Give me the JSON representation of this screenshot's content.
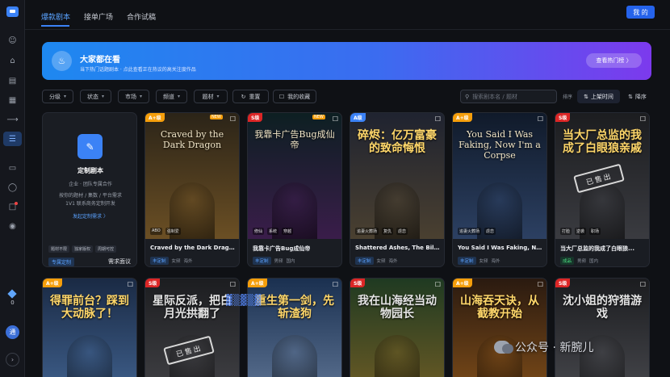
{
  "header": {
    "tabs": [
      {
        "label": "爆款剧本",
        "active": true
      },
      {
        "label": "接单广场",
        "active": false
      },
      {
        "label": "合作试稿",
        "active": false
      }
    ],
    "my_button": "我 的"
  },
  "sidebar": {
    "credits": "0",
    "avatar_letter": "通"
  },
  "banner": {
    "title": "大家都在看",
    "subtitle": "当下热门话题剧本 · 点此查看正在热议的高关注度作品",
    "button": "查看热门榜 〉"
  },
  "filters": [
    {
      "label": "分级"
    },
    {
      "label": "状态"
    },
    {
      "label": "市场"
    },
    {
      "label": "频道"
    },
    {
      "label": "题材"
    }
  ],
  "actions": {
    "reset": "重置",
    "favorites": "我的收藏"
  },
  "search": {
    "placeholder": "搜索剧本名 / 题材"
  },
  "sort": {
    "label": "排序",
    "option_a": "上架时间",
    "option_b": "降序"
  },
  "custom_card": {
    "title": "定制剧本",
    "line1": "企业 · 团队专属合作",
    "line2": "按你的题材 / 集数 / 平台需求",
    "line3": "1V1 联系商务定制开发",
    "link": "发起定制需求 〉",
    "tags": [
      "题材不限",
      "独家版权",
      "周期可控"
    ],
    "footer_tag": "专属定制",
    "footer_right": "需求面议"
  },
  "cards_row1": [
    {
      "grade": "A+级",
      "new": "NEW",
      "cover_title": "Craved by the Dark Dragon",
      "cover_tags": [
        "ABO",
        "强制爱"
      ],
      "name": "Craved by the Dark Drago...",
      "status": "丰定制",
      "meta1": "女频",
      "meta2": "海外",
      "colors": [
        "#2b2418",
        "#6b4f24"
      ]
    },
    {
      "grade": "S级",
      "new": "NEW",
      "cover_title": "我靠卡广告Bug成仙帝",
      "cover_tags": [
        "修仙",
        "系统",
        "穿越"
      ],
      "name": "我靠卡广告Bug成仙帝",
      "status": "丰定制",
      "meta1": "男频",
      "meta2": "国内",
      "colors": [
        "#0d1f22",
        "#3a1d4a"
      ]
    },
    {
      "grade": "A级",
      "new": "",
      "cover_title": "碎烬：亿万富豪的致命悔恨",
      "cover_tags": [
        "追妻火葬场",
        "复仇",
        "虐恋"
      ],
      "name": "Shattered Ashes, The Billi...",
      "status": "丰定制",
      "meta1": "女频",
      "meta2": "海外",
      "colors": [
        "#1f2330",
        "#4a4030"
      ]
    },
    {
      "grade": "A+级",
      "new": "",
      "cover_title": "You Said I Was Faking, Now I'm a Corpse",
      "cover_tags": [
        "追妻火葬场",
        "虐恋"
      ],
      "name": "You Said I Was Faking, No...",
      "status": "丰定制",
      "meta1": "女频",
      "meta2": "海外",
      "colors": [
        "#101a2a",
        "#2c4062"
      ]
    },
    {
      "grade": "S级",
      "new": "",
      "cover_title": "当大厂总监的我成了白眼狼亲戚",
      "cover_tags": [
        "打脸",
        "逆袭",
        "职场"
      ],
      "name": "当大厂总监的我成了白眼狼...",
      "status": "成品",
      "meta1": "男频",
      "meta2": "国内",
      "soldout": "已售出",
      "colors": [
        "#1c1d20",
        "#3a3b40"
      ]
    }
  ],
  "cards_row2": [
    {
      "grade": "A+级",
      "cover_title": "得罪前台？踩到大动脉了！",
      "colors": [
        "#1a2a44",
        "#3e5e8a"
      ]
    },
    {
      "grade": "S级",
      "cover_title": "星际反派，把白月光拱翻了",
      "soldout": "已售出",
      "colors": [
        "#1c1d20",
        "#404044"
      ]
    },
    {
      "grade": "A+级",
      "cover_title": "重生第一剑，先斩渣狗",
      "colors": [
        "#1a3050",
        "#5a7090"
      ]
    },
    {
      "grade": "S级",
      "cover_title": "我在山海经当动物园长",
      "colors": [
        "#1f3a22",
        "#6a5a24"
      ]
    },
    {
      "grade": "A+级",
      "cover_title": "山海吞天诀，从截教开始",
      "colors": [
        "#2a1a10",
        "#7a4a18"
      ]
    },
    {
      "grade": "S级",
      "cover_title": "沈小姐的狩猎游戏",
      "colors": [
        "#1b1c1f",
        "#45464b"
      ]
    }
  ],
  "watermark": "公众号 · 新腕儿"
}
